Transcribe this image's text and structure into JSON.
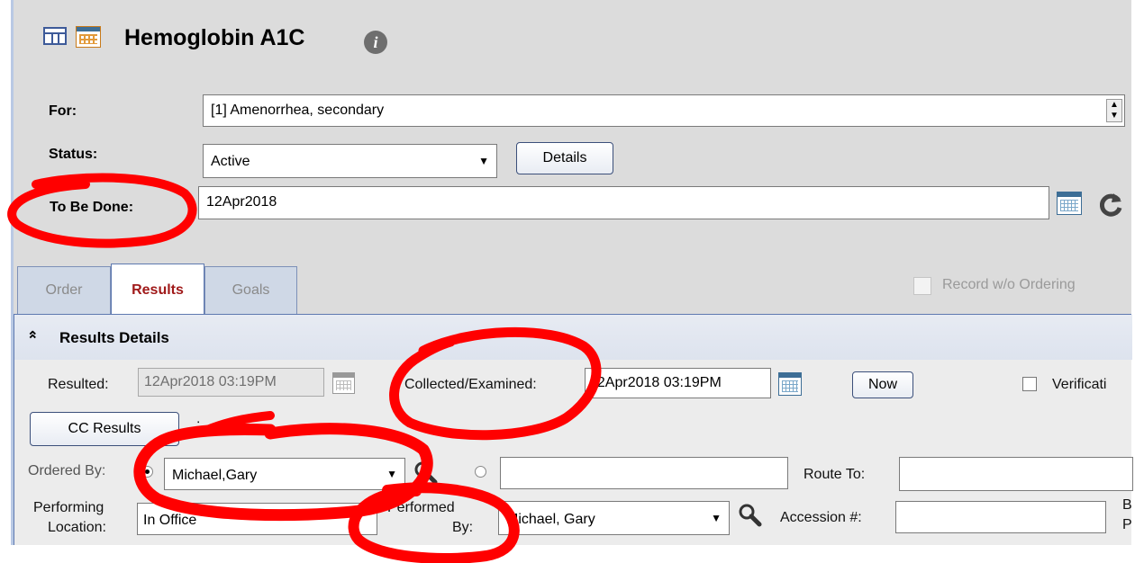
{
  "header": {
    "title": "Hemoglobin A1C"
  },
  "form": {
    "for_label": "For:",
    "for_value": "[1] Amenorrhea, secondary",
    "status_label": "Status:",
    "status_value": "Active",
    "details_button": "Details",
    "to_be_done_label": "To Be Done:",
    "to_be_done_value": "12Apr2018"
  },
  "tabs": [
    {
      "label": "Order"
    },
    {
      "label": "Results"
    },
    {
      "label": "Goals"
    }
  ],
  "record_without_ordering": "Record w/o Ordering",
  "results": {
    "section_title": "Results Details",
    "resulted_label": "Resulted:",
    "resulted_value": "12Apr2018 03:19PM",
    "collected_label": "Collected/Examined:",
    "collected_value": "12Apr2018 03:19PM",
    "now_button": "Now",
    "verification_label": "Verificati",
    "cc_results_button": "CC Results",
    "colon": ":",
    "ordered_by_label": "Ordered By:",
    "ordered_by_value": "Michael,Gary",
    "route_to_label": "Route To:",
    "performing_location_label_1": "Performing",
    "performing_location_label_2": "Location:",
    "performing_location_value": "In Office",
    "performed_by_label_1": "Performed",
    "performed_by_label_2": "By:",
    "performed_by_value": "Michael, Gary",
    "accession_label": "Accession #:",
    "cut_label_1": "B",
    "cut_label_2": "P"
  },
  "colors": {
    "annotation_red": "#ff0000",
    "active_tab_text": "#a01a1a"
  }
}
